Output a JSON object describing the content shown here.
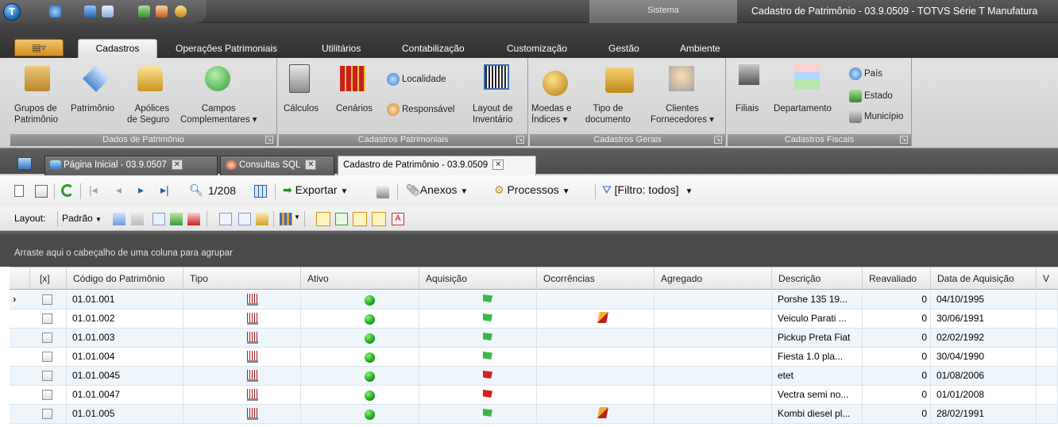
{
  "window": {
    "sistema_label": "Sistema",
    "title": "Cadastro de Patrimônio - 03.9.0509 - TOTVS Série T Manufatura"
  },
  "ribbon_tabs": [
    "Cadastros",
    "Operações Patrimoniais",
    "Utilitários",
    "Contabilização",
    "Customização",
    "Gestão",
    "Ambiente"
  ],
  "ribbon": {
    "dados_patrimonio": {
      "title": "Dados de Patrimônio",
      "grupos": "Grupos de\nPatrimônio",
      "patrimonio": "Patrimônio",
      "apolices": "Apólices\nde Seguro",
      "campos": "Campos\nComplementares ▾"
    },
    "cadastros_patrimoniais": {
      "title": "Cadastros Patrimoniais",
      "calculos": "Cálculos",
      "cenarios": "Cenários",
      "localidade": "Localidade",
      "responsavel": "Responsável",
      "layout": "Layout de\nInventário"
    },
    "cadastros_gerais": {
      "title": "Cadastros Gerais",
      "moedas": "Moedas e\nÍndices ▾",
      "tipo_doc": "Tipo de\ndocumento",
      "clientes": "Clientes\nFornecedores ▾"
    },
    "cadastros_fiscais": {
      "title": "Cadastros Fiscais",
      "filiais": "Filiais",
      "departamento": "Departamento",
      "pais": "País",
      "estado": "Estado",
      "municipio": "Município"
    }
  },
  "doc_tabs": [
    {
      "label": "Página Inicial - 03.9.0507",
      "active": false
    },
    {
      "label": "Consultas SQL",
      "active": false
    },
    {
      "label": "Cadastro de Patrimônio - 03.9.0509",
      "active": true
    }
  ],
  "toolbar": {
    "record_counter": "1/208",
    "exportar": "Exportar",
    "anexos": "Anexos",
    "processos": "Processos",
    "filtro": "[Filtro: todos]",
    "layout_label": "Layout:",
    "layout_value": "Padrão"
  },
  "group_hint": "Arraste aqui o cabeçalho de uma coluna para agrupar",
  "grid": {
    "columns": [
      "[x]",
      "Código do Patrimônio",
      "Tipo",
      "Ativo",
      "Aquisição",
      "Ocorrências",
      "Agregado",
      "Descrição",
      "Reavaliado",
      "Data de Aquisição",
      "V"
    ],
    "rows": [
      {
        "codigo": "01.01.001",
        "aquisicao": "green",
        "ocorrencia": false,
        "descricao": "Porshe 135 19...",
        "reavaliado": "0",
        "data": "04/10/1995"
      },
      {
        "codigo": "01.01.002",
        "aquisicao": "green",
        "ocorrencia": true,
        "descricao": "Veiculo Parati ...",
        "reavaliado": "0",
        "data": "30/06/1991"
      },
      {
        "codigo": "01.01.003",
        "aquisicao": "green",
        "ocorrencia": false,
        "descricao": "Pickup Preta Fiat",
        "reavaliado": "0",
        "data": "02/02/1992"
      },
      {
        "codigo": "01.01.004",
        "aquisicao": "green",
        "ocorrencia": false,
        "descricao": "Fiesta 1.0  pla...",
        "reavaliado": "0",
        "data": "30/04/1990"
      },
      {
        "codigo": "01.01.0045",
        "aquisicao": "red",
        "ocorrencia": false,
        "descricao": "etet",
        "reavaliado": "0",
        "data": "01/08/2006"
      },
      {
        "codigo": "01.01.0047",
        "aquisicao": "red",
        "ocorrencia": false,
        "descricao": "Vectra semi no...",
        "reavaliado": "0",
        "data": "01/01/2008"
      },
      {
        "codigo": "01.01.005",
        "aquisicao": "green",
        "ocorrencia": true,
        "descricao": "Kombi  diesel pl...",
        "reavaliado": "0",
        "data": "28/02/1991"
      }
    ]
  },
  "colors": {
    "ribbon_dark": "#3c3c3c",
    "active_green": "#1ba81e",
    "flag_green": "#3db54a",
    "flag_red": "#d42020",
    "row_alt": "#eef5fb"
  }
}
